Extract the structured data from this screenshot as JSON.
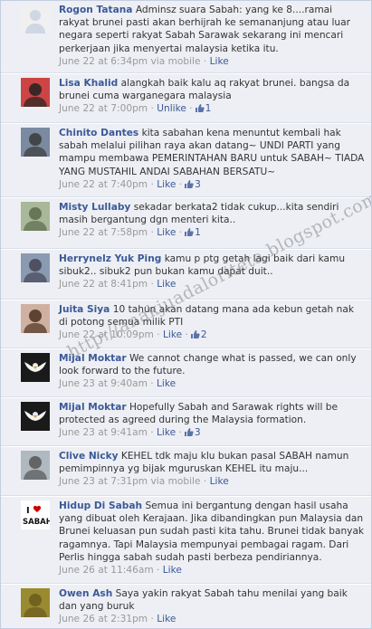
{
  "comments": [
    {
      "author": "Rogon Tatana",
      "text": "Adminsz suara Sabah: yang ke 8....ramai rakyat brunei pasti akan berhijrah ke semananjung atau luar negara seperti rakyat Sabah Sarawak sekarang ini mencari perkerjaan jika menyertai malaysia ketika itu.",
      "time": "June 22 at 6:34pm via mobile",
      "action": "Like",
      "likes": "",
      "avatar_icon": "default-silhouette-icon"
    },
    {
      "author": "Lisa Khalid",
      "text": "alangkah baik kalu aq rakyat brunei. bangsa da brunei cuma warganegara malaysia",
      "time": "June 22 at 7:00pm",
      "action": "Unlike",
      "likes": "1",
      "avatar_icon": "profile-photo-icon"
    },
    {
      "author": "Chinito Dantes",
      "text": "kita sabahan kena menuntut kembali hak sabah melalui pilihan raya akan datang~ UNDI PARTI yang mampu membawa PEMERINTAHAN BARU untuk SABAH~ TIADA YANG MUSTAHIL ANDAI SABAHAN BERSATU~",
      "time": "June 22 at 7:40pm",
      "action": "Like",
      "likes": "3",
      "avatar_icon": "profile-photo-icon"
    },
    {
      "author": "Misty Lullaby",
      "text": "sekadar berkata2 tidak cukup...kita sendiri masih bergantung dgn menteri kita..",
      "time": "June 22 at 7:58pm",
      "action": "Like",
      "likes": "1",
      "avatar_icon": "profile-photo-icon"
    },
    {
      "author": "Herrynelz Yuk Ping",
      "text": "kamu p ptg getah lagi baik dari kamu sibuk2.. sibuk2 pun bukan kamu dapat duit..",
      "time": "June 22 at 8:41pm",
      "action": "Like",
      "likes": "",
      "avatar_icon": "profile-photo-icon"
    },
    {
      "author": "Juita Siya",
      "text": "10 tahun akan datang mana ada kebun getah nak di potong semua milik PTI",
      "time": "June 22 at 10:09pm",
      "action": "Like",
      "likes": "2",
      "avatar_icon": "profile-photo-icon"
    },
    {
      "author": "Mijal Moktar",
      "text": "We cannot change what is passed, we can only look forward to the future.",
      "time": "June 23 at 9:40am",
      "action": "Like",
      "likes": "",
      "avatar_icon": "eagle-icon"
    },
    {
      "author": "Mijal Moktar",
      "text": "Hopefully Sabah and Sarawak rights will be protected as agreed during the Malaysia formation.",
      "time": "June 23 at 9:41am",
      "action": "Like",
      "likes": "3",
      "avatar_icon": "eagle-icon"
    },
    {
      "author": "Clive Nicky",
      "text": "KEHEL tdk maju klu bukan pasal SABAH namun pemimpinnya yg bijak mguruskan KEHEL itu maju...",
      "time": "June 23 at 7:31pm via mobile",
      "action": "Like",
      "likes": "",
      "avatar_icon": "profile-photo-icon"
    },
    {
      "author": "Hidup Di Sabah",
      "text": "Semua ini bergantung dengan hasil usaha yang dibuat oleh Kerajaan. Jika dibandingkan pun Malaysia dan Brunei keluasan pun sudah pasti kita tahu. Brunei tidak banyak ragamnya. Tapi Malaysia mempunyai pembagai ragam. Dari Perlis hingga sabah sudah pasti berbeza pendiriannya.",
      "time": "June 26 at 11:46am",
      "action": "Like",
      "likes": "",
      "avatar_icon": "i-love-sabah-icon",
      "avatar_text": {
        "line1": "I",
        "line2": "SABAH"
      }
    },
    {
      "author": "Owen Ash",
      "text": "Saya yakin rakyat Sabah tahu menilai yang baik dan yang buruk",
      "time": "June 26 at 2:31pm",
      "action": "Like",
      "likes": "",
      "avatar_icon": "profile-photo-icon"
    }
  ],
  "separator": "·",
  "watermark": "http://anakjuadaloriteta.blogspot.com",
  "colors": {
    "background": "#edeff4",
    "link": "#3b5998",
    "meta": "#999999",
    "text": "#333333"
  }
}
